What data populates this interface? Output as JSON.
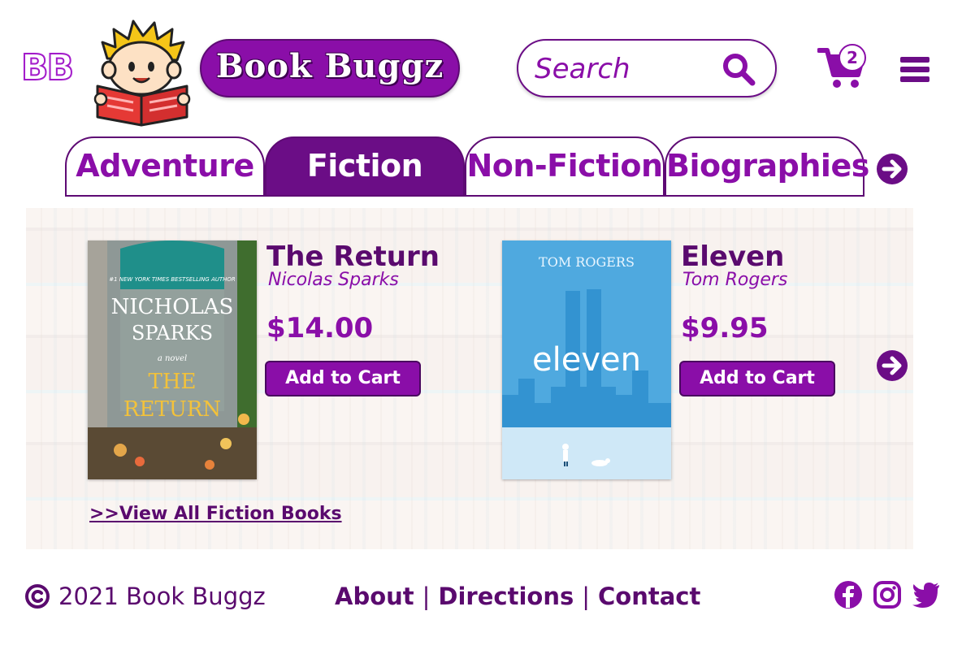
{
  "header": {
    "monogram": "BB",
    "brand_name": "Book Buggz",
    "search": {
      "placeholder": "Search",
      "value": ""
    },
    "cart_count": "2"
  },
  "tabs": [
    {
      "label": "Adventure",
      "active": false
    },
    {
      "label": "Fiction",
      "active": true
    },
    {
      "label": "Non-Fiction",
      "active": false
    },
    {
      "label": "Biographies",
      "active": false
    }
  ],
  "products": [
    {
      "title": "The Return",
      "author": "Nicolas Sparks",
      "price": "$14.00",
      "button": "Add to Cart",
      "cover": {
        "tagline": "#1 NEW YORK TIMES BESTSELLING AUTHOR",
        "author_line1": "NICHOLAS",
        "author_line2": "SPARKS",
        "subtitle": "a novel",
        "title_line1": "THE",
        "title_line2": "RETURN"
      }
    },
    {
      "title": "Eleven",
      "author": "Tom Rogers",
      "price": "$9.95",
      "button": "Add to Cart",
      "cover": {
        "author": "TOM ROGERS",
        "title": "eleven"
      }
    }
  ],
  "view_all": ">>View All Fiction Books",
  "footer": {
    "copyright": "2021 Book Buggz",
    "links": [
      "About",
      "Directions",
      "Contact"
    ],
    "separator": "|"
  },
  "colors": {
    "primary": "#8a0ea8",
    "dark": "#6b0d86",
    "text": "#5a0a6e"
  }
}
